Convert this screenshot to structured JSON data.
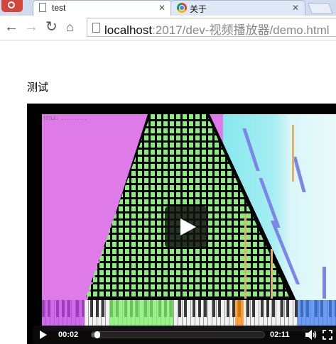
{
  "browser": {
    "tabs": [
      {
        "title": "test",
        "active": true
      },
      {
        "title": "关于",
        "active": false
      }
    ],
    "url_host": "localhost",
    "url_path": ":2017/dev-视频播放器/demo.html"
  },
  "page": {
    "heading": "测试"
  },
  "video": {
    "overlay_text": "TITLE: ..........",
    "current_time": "00:02",
    "duration": "02:11",
    "progress_fraction": 0.015,
    "colors": {
      "magenta": "#df7ae9",
      "green": "#86ef76",
      "cyan": "#86e8ee",
      "blue_streak": "#7b86e6"
    }
  }
}
